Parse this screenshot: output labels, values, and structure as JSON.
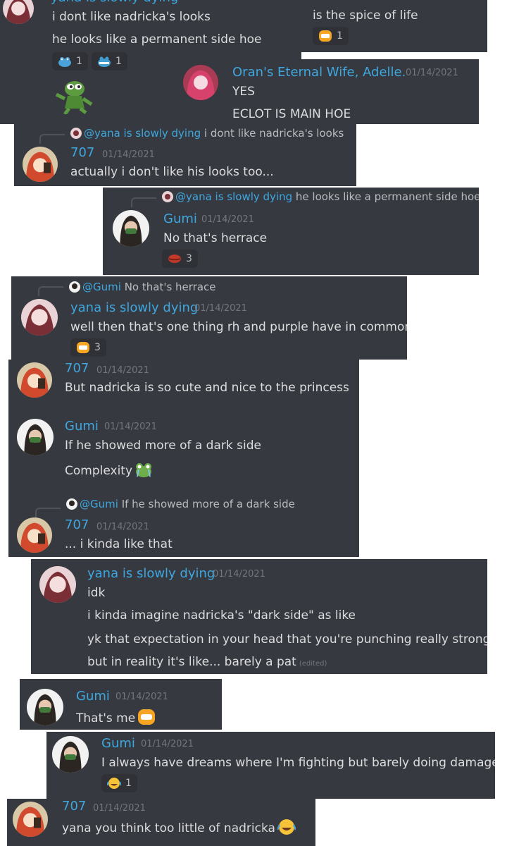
{
  "users": {
    "yana": "yana is slowly dying",
    "adelle": "Oran's Eternal Wife, Adelle.",
    "u707": "707",
    "gumi": "Gumi"
  },
  "date": "01/14/2021",
  "date_partial": "01/14/2021",
  "colors": {
    "panel": "#36393f",
    "username": "#3ea7e0",
    "text": "#dcddde",
    "timestamp": "#72767d"
  },
  "p1": {
    "msg1": "i dont like nadricka's looks",
    "msg2": "he looks like a permanent side hoe",
    "reactions": [
      {
        "icon": "frog-blue-icon",
        "count": "1"
      },
      {
        "icon": "frog-angry-icon",
        "count": "1"
      }
    ],
    "sticker": "pepe-dancing-icon"
  },
  "p2": {
    "msg": "is the spice of life",
    "reaction_count": "1"
  },
  "p3": {
    "msg1": "YES",
    "msg2": "ECLOT IS MAIN HOE"
  },
  "p4": {
    "reply_mention": "@yana is slowly dying",
    "reply_text": "i dont like nadricka's looks",
    "msg": "actually i don't like his looks too..."
  },
  "p5": {
    "reply_mention": "@yana is slowly dying",
    "reply_text": "he looks like a permanent side hoe",
    "msg": "No that's herrace",
    "reaction_count": "3"
  },
  "p6": {
    "reply_mention": "@Gumi",
    "reply_text": "No that's herrace",
    "msg": "well then that's one thing rh and purple have in common",
    "reaction_count": "3"
  },
  "p7": {
    "msg_707": "But nadricka is so cute and nice to the princess",
    "gumi_msg1": "If he showed more of a dark side",
    "gumi_msg2": "Complexity",
    "reply_mention": "@Gumi",
    "reply_text": "If he showed more of a dark side",
    "msg_707b": "... i kinda like that"
  },
  "p8": {
    "lines": [
      "idk",
      "i kinda imagine nadricka's \"dark side\" as like",
      "yk that expectation in your head that you're punching really strong",
      "but in reality it's like... barely a pat"
    ],
    "edited": "(edited)"
  },
  "p9": {
    "msg": "That's me"
  },
  "p10": {
    "msg": "I always have dreams where I'm fighting but barely doing damage",
    "reaction_count": "1"
  },
  "p11": {
    "msg": "yana you think too little of nadricka"
  }
}
